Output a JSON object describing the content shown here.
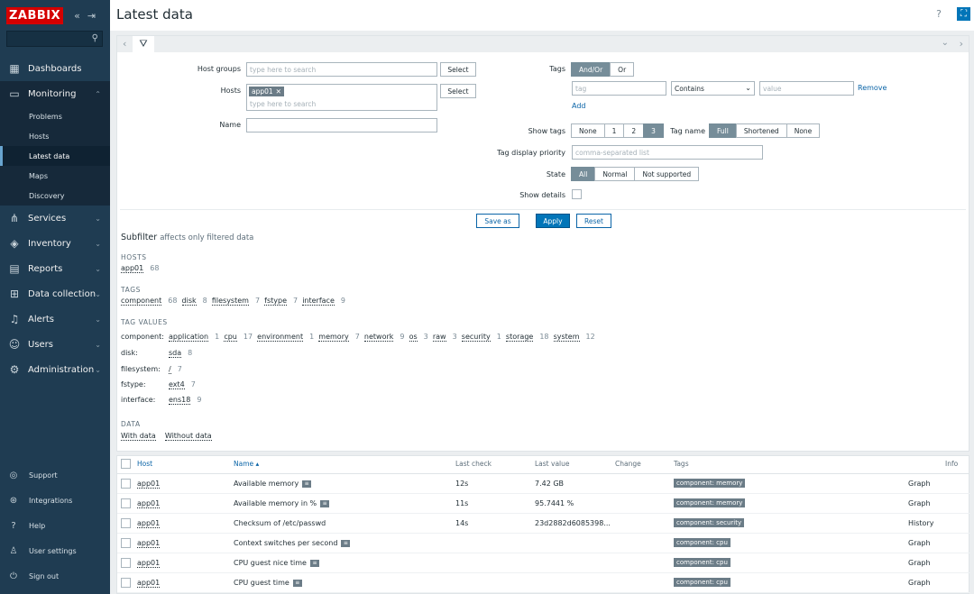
{
  "brand": {
    "logo": "ZABBIX"
  },
  "nav": {
    "items": [
      {
        "label": "Dashboards"
      },
      {
        "label": "Monitoring"
      },
      {
        "label": "Services"
      },
      {
        "label": "Inventory"
      },
      {
        "label": "Reports"
      },
      {
        "label": "Data collection"
      },
      {
        "label": "Alerts"
      },
      {
        "label": "Users"
      },
      {
        "label": "Administration"
      }
    ],
    "monitoring_sub": [
      "Problems",
      "Hosts",
      "Latest data",
      "Maps",
      "Discovery"
    ],
    "bottom": [
      "Support",
      "Integrations",
      "Help",
      "User settings",
      "Sign out"
    ]
  },
  "header": {
    "title": "Latest data",
    "help": "?"
  },
  "filter": {
    "host_groups_label": "Host groups",
    "hosts_label": "Hosts",
    "name_label": "Name",
    "search_placeholder": "type here to search",
    "select_label": "Select",
    "host_chip": "app01",
    "name_value": "",
    "tags_label": "Tags",
    "tags_andor": "And/Or",
    "tags_or": "Or",
    "tag_placeholder": "tag",
    "operator": "Contains",
    "value_placeholder": "value",
    "remove": "Remove",
    "add": "Add",
    "show_tags_label": "Show tags",
    "show_tags_options": [
      "None",
      "1",
      "2",
      "3"
    ],
    "tag_name_label": "Tag name",
    "tag_name_options": [
      "Full",
      "Shortened",
      "None"
    ],
    "tag_priority_label": "Tag display priority",
    "tag_priority_placeholder": "comma-separated list",
    "state_label": "State",
    "state_options": [
      "All",
      "Normal",
      "Not supported"
    ],
    "show_details_label": "Show details",
    "save_as": "Save as",
    "apply": "Apply",
    "reset": "Reset"
  },
  "subfilter": {
    "title": "Subfilter",
    "subtitle": "affects only filtered data",
    "hosts_heading": "HOSTS",
    "hosts": [
      {
        "name": "app01",
        "count": "68"
      }
    ],
    "tags_heading": "TAGS",
    "tags": [
      {
        "name": "component",
        "count": "68"
      },
      {
        "name": "disk",
        "count": "8"
      },
      {
        "name": "filesystem",
        "count": "7"
      },
      {
        "name": "fstype",
        "count": "7"
      },
      {
        "name": "interface",
        "count": "9"
      }
    ],
    "tag_values_heading": "TAG VALUES",
    "tag_values": [
      {
        "label": "component:",
        "values": [
          {
            "name": "application",
            "count": "1"
          },
          {
            "name": "cpu",
            "count": "17"
          },
          {
            "name": "environment",
            "count": "1"
          },
          {
            "name": "memory",
            "count": "7"
          },
          {
            "name": "network",
            "count": "9"
          },
          {
            "name": "os",
            "count": "3"
          },
          {
            "name": "raw",
            "count": "3"
          },
          {
            "name": "security",
            "count": "1"
          },
          {
            "name": "storage",
            "count": "18"
          },
          {
            "name": "system",
            "count": "12"
          }
        ]
      },
      {
        "label": "disk:",
        "values": [
          {
            "name": "sda",
            "count": "8"
          }
        ]
      },
      {
        "label": "filesystem:",
        "values": [
          {
            "name": "/",
            "count": "7"
          }
        ]
      },
      {
        "label": "fstype:",
        "values": [
          {
            "name": "ext4",
            "count": "7"
          }
        ]
      },
      {
        "label": "interface:",
        "values": [
          {
            "name": "ens18",
            "count": "9"
          }
        ]
      }
    ],
    "data_heading": "DATA",
    "data": [
      "With data",
      "Without data"
    ]
  },
  "table": {
    "columns": {
      "host": "Host",
      "name": "Name ▴",
      "last_check": "Last check",
      "last_value": "Last value",
      "change": "Change",
      "tags": "Tags",
      "info": "Info"
    },
    "rows": [
      {
        "host": "app01",
        "name": "Available memory",
        "last_check": "12s",
        "last_value": "7.42 GB",
        "tag": "component: memory",
        "action": "Graph"
      },
      {
        "host": "app01",
        "name": "Available memory in %",
        "last_check": "11s",
        "last_value": "95.7441 %",
        "tag": "component: memory",
        "action": "Graph"
      },
      {
        "host": "app01",
        "name": "Checksum of /etc/passwd",
        "last_check": "14s",
        "last_value": "23d2882d6085398...",
        "tag": "component: security",
        "action": "History"
      },
      {
        "host": "app01",
        "name": "Context switches per second",
        "last_check": "",
        "last_value": "",
        "tag": "component: cpu",
        "action": "Graph"
      },
      {
        "host": "app01",
        "name": "CPU guest nice time",
        "last_check": "",
        "last_value": "",
        "tag": "component: cpu",
        "action": "Graph"
      },
      {
        "host": "app01",
        "name": "CPU guest time",
        "last_check": "",
        "last_value": "",
        "tag": "component: cpu",
        "action": "Graph"
      }
    ]
  },
  "colors": {
    "sidebar": "#1f3c52",
    "accent": "#0275b8",
    "logo": "#d40000"
  }
}
